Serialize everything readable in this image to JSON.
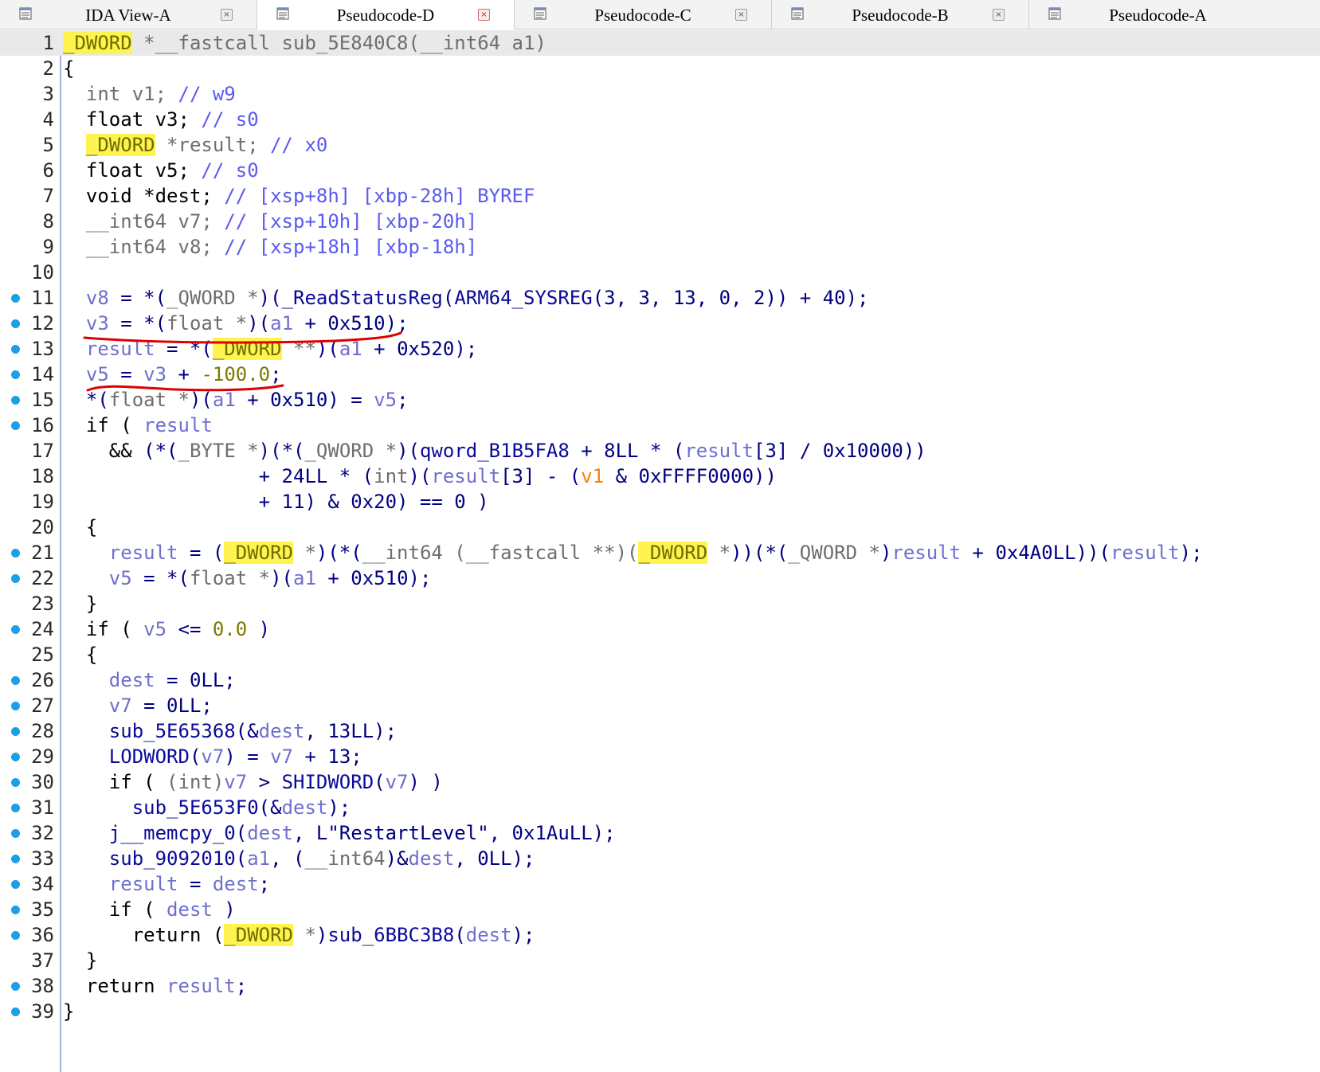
{
  "tabs": [
    {
      "label": "IDA View-A",
      "active": false
    },
    {
      "label": "Pseudocode-D",
      "active": true
    },
    {
      "label": "Pseudocode-C",
      "active": false
    },
    {
      "label": "Pseudocode-B",
      "active": false
    },
    {
      "label": "Pseudocode-A",
      "active": false
    }
  ],
  "close_glyph": "×",
  "colors": {
    "keyword": "#000080",
    "local_var": "#6f6fce",
    "type_gray": "#6e6e6e",
    "comment": "#5a5af0",
    "highlight_bg": "#fff34f",
    "breakpoint_dot": "#1aa0e8",
    "float_literal": "#7a7a00",
    "global_var": "#ff7f00",
    "annotation": "#e00000"
  },
  "code_lines": [
    {
      "n": "1",
      "bp": false,
      "current": true,
      "tokens": [
        [
          "hl",
          "_DWORD"
        ],
        [
          "ty",
          " *__fastcall "
        ],
        [
          "ty",
          "sub_5E840C8"
        ],
        [
          "ty",
          "(__int64 a1)"
        ]
      ]
    },
    {
      "n": "2",
      "bp": false,
      "tokens": [
        [
          "d",
          "{"
        ]
      ]
    },
    {
      "n": "3",
      "bp": false,
      "tokens": [
        [
          "d",
          "  "
        ],
        [
          "ty",
          "int v1; "
        ],
        [
          "cm",
          "// w9"
        ]
      ]
    },
    {
      "n": "4",
      "bp": false,
      "tokens": [
        [
          "d",
          "  float v3; "
        ],
        [
          "cm",
          "// s0"
        ]
      ]
    },
    {
      "n": "5",
      "bp": false,
      "tokens": [
        [
          "d",
          "  "
        ],
        [
          "hl",
          "_DWORD"
        ],
        [
          "ty",
          " *result; "
        ],
        [
          "cm",
          "// x0"
        ]
      ]
    },
    {
      "n": "6",
      "bp": false,
      "tokens": [
        [
          "d",
          "  float v5; "
        ],
        [
          "cm",
          "// s0"
        ]
      ]
    },
    {
      "n": "7",
      "bp": false,
      "tokens": [
        [
          "d",
          "  void *dest; "
        ],
        [
          "cm",
          "// [xsp+8h] [xbp-28h] BYREF"
        ]
      ]
    },
    {
      "n": "8",
      "bp": false,
      "tokens": [
        [
          "d",
          "  "
        ],
        [
          "ty",
          "__int64 v7; "
        ],
        [
          "cm",
          "// [xsp+10h] [xbp-20h]"
        ]
      ]
    },
    {
      "n": "9",
      "bp": false,
      "tokens": [
        [
          "d",
          "  "
        ],
        [
          "ty",
          "__int64 v8; "
        ],
        [
          "cm",
          "// [xsp+18h] [xbp-18h]"
        ]
      ]
    },
    {
      "n": "10",
      "bp": false,
      "tokens": []
    },
    {
      "n": "11",
      "bp": true,
      "tokens": [
        [
          "d",
          "  "
        ],
        [
          "lv",
          "v8"
        ],
        [
          "k",
          " = *("
        ],
        [
          "ty",
          "_QWORD *"
        ],
        [
          "k",
          ")("
        ],
        [
          "fn",
          "_ReadStatusReg"
        ],
        [
          "k",
          "("
        ],
        [
          "fn",
          "ARM64_SYSREG"
        ],
        [
          "k",
          "(3, 3, 13, 0, 2)) + 40);"
        ]
      ]
    },
    {
      "n": "12",
      "bp": true,
      "tokens": [
        [
          "d",
          "  "
        ],
        [
          "lv",
          "v3"
        ],
        [
          "k",
          " = *("
        ],
        [
          "ty",
          "float *"
        ],
        [
          "k",
          ")("
        ],
        [
          "lv",
          "a1"
        ],
        [
          "k",
          " + 0x510);"
        ]
      ]
    },
    {
      "n": "13",
      "bp": true,
      "tokens": [
        [
          "d",
          "  "
        ],
        [
          "lv",
          "result"
        ],
        [
          "k",
          " = *("
        ],
        [
          "hl",
          "_DWORD"
        ],
        [
          "ty",
          " **"
        ],
        [
          "k",
          ")("
        ],
        [
          "lv",
          "a1"
        ],
        [
          "k",
          " + 0x520);"
        ]
      ]
    },
    {
      "n": "14",
      "bp": true,
      "tokens": [
        [
          "d",
          "  "
        ],
        [
          "lv",
          "v5"
        ],
        [
          "k",
          " = "
        ],
        [
          "lv",
          "v3"
        ],
        [
          "k",
          " + "
        ],
        [
          "flt",
          "-100.0"
        ],
        [
          "k",
          ";"
        ]
      ]
    },
    {
      "n": "15",
      "bp": true,
      "tokens": [
        [
          "d",
          "  "
        ],
        [
          "k",
          "*("
        ],
        [
          "ty",
          "float *"
        ],
        [
          "k",
          ")("
        ],
        [
          "lv",
          "a1"
        ],
        [
          "k",
          " + 0x510) = "
        ],
        [
          "lv",
          "v5"
        ],
        [
          "k",
          ";"
        ]
      ]
    },
    {
      "n": "16",
      "bp": true,
      "tokens": [
        [
          "d",
          "  if ( "
        ],
        [
          "lv",
          "result"
        ]
      ]
    },
    {
      "n": "17",
      "bp": false,
      "tokens": [
        [
          "d",
          "    && "
        ],
        [
          "k",
          "(*("
        ],
        [
          "ty",
          "_BYTE *"
        ],
        [
          "k",
          ")(*("
        ],
        [
          "ty",
          "_QWORD *"
        ],
        [
          "k",
          ")("
        ],
        [
          "fn",
          "qword_B1B5FA8"
        ],
        [
          "k",
          " + 8LL * ("
        ],
        [
          "lv",
          "result"
        ],
        [
          "k",
          "[3] / 0x10000))"
        ]
      ]
    },
    {
      "n": "18",
      "bp": false,
      "tokens": [
        [
          "d",
          "                 "
        ],
        [
          "k",
          "+ 24LL * ("
        ],
        [
          "ty",
          "int"
        ],
        [
          "k",
          ")("
        ],
        [
          "lv",
          "result"
        ],
        [
          "k",
          "[3] - ("
        ],
        [
          "or",
          "v1"
        ],
        [
          "k",
          " & 0xFFFF0000))"
        ]
      ]
    },
    {
      "n": "19",
      "bp": false,
      "tokens": [
        [
          "d",
          "                 "
        ],
        [
          "k",
          "+ 11) & 0x20) == 0 )"
        ]
      ]
    },
    {
      "n": "20",
      "bp": false,
      "tokens": [
        [
          "d",
          "  {"
        ]
      ]
    },
    {
      "n": "21",
      "bp": true,
      "tokens": [
        [
          "d",
          "    "
        ],
        [
          "lv",
          "result"
        ],
        [
          "k",
          " = ("
        ],
        [
          "hl",
          "_DWORD"
        ],
        [
          "ty",
          " *"
        ],
        [
          "k",
          ")(*("
        ],
        [
          "ty",
          "__int64 (__fastcall **)("
        ],
        [
          "hl",
          "_DWORD"
        ],
        [
          "ty",
          " *"
        ],
        [
          "k",
          "))(*("
        ],
        [
          "ty",
          "_QWORD *"
        ],
        [
          "k",
          ")"
        ],
        [
          "lv",
          "result"
        ],
        [
          "k",
          " + 0x4A0LL))("
        ],
        [
          "lv",
          "result"
        ],
        [
          "k",
          ");"
        ]
      ]
    },
    {
      "n": "22",
      "bp": true,
      "tokens": [
        [
          "d",
          "    "
        ],
        [
          "lv",
          "v5"
        ],
        [
          "k",
          " = *("
        ],
        [
          "ty",
          "float *"
        ],
        [
          "k",
          ")("
        ],
        [
          "lv",
          "a1"
        ],
        [
          "k",
          " + 0x510);"
        ]
      ]
    },
    {
      "n": "23",
      "bp": false,
      "tokens": [
        [
          "d",
          "  }"
        ]
      ]
    },
    {
      "n": "24",
      "bp": true,
      "tokens": [
        [
          "d",
          "  if ( "
        ],
        [
          "lv",
          "v5"
        ],
        [
          "k",
          " <= "
        ],
        [
          "flt",
          "0.0"
        ],
        [
          "k",
          " )"
        ]
      ]
    },
    {
      "n": "25",
      "bp": false,
      "tokens": [
        [
          "d",
          "  {"
        ]
      ]
    },
    {
      "n": "26",
      "bp": true,
      "tokens": [
        [
          "d",
          "    "
        ],
        [
          "lv",
          "dest"
        ],
        [
          "k",
          " = 0LL;"
        ]
      ]
    },
    {
      "n": "27",
      "bp": true,
      "tokens": [
        [
          "d",
          "    "
        ],
        [
          "lv",
          "v7"
        ],
        [
          "k",
          " = 0LL;"
        ]
      ]
    },
    {
      "n": "28",
      "bp": true,
      "tokens": [
        [
          "d",
          "    "
        ],
        [
          "fn",
          "sub_5E65368"
        ],
        [
          "k",
          "(&"
        ],
        [
          "lv",
          "dest"
        ],
        [
          "k",
          ", 13LL);"
        ]
      ]
    },
    {
      "n": "29",
      "bp": true,
      "tokens": [
        [
          "d",
          "    "
        ],
        [
          "fn",
          "LODWORD"
        ],
        [
          "k",
          "("
        ],
        [
          "lv",
          "v7"
        ],
        [
          "k",
          ") = "
        ],
        [
          "lv",
          "v7"
        ],
        [
          "k",
          " + 13;"
        ]
      ]
    },
    {
      "n": "30",
      "bp": true,
      "tokens": [
        [
          "d",
          "    if ( "
        ],
        [
          "ty",
          "(int)"
        ],
        [
          "lv",
          "v7"
        ],
        [
          "k",
          " > "
        ],
        [
          "fn",
          "SHIDWORD"
        ],
        [
          "k",
          "("
        ],
        [
          "lv",
          "v7"
        ],
        [
          "k",
          ") )"
        ]
      ]
    },
    {
      "n": "31",
      "bp": true,
      "tokens": [
        [
          "d",
          "      "
        ],
        [
          "fn",
          "sub_5E653F0"
        ],
        [
          "k",
          "(&"
        ],
        [
          "lv",
          "dest"
        ],
        [
          "k",
          ");"
        ]
      ]
    },
    {
      "n": "32",
      "bp": true,
      "tokens": [
        [
          "d",
          "    "
        ],
        [
          "fn",
          "j__memcpy_0"
        ],
        [
          "k",
          "("
        ],
        [
          "lv",
          "dest"
        ],
        [
          "k",
          ", "
        ],
        [
          "str",
          "L\"RestartLevel\""
        ],
        [
          "k",
          ", 0x1AuLL);"
        ]
      ]
    },
    {
      "n": "33",
      "bp": true,
      "tokens": [
        [
          "d",
          "    "
        ],
        [
          "fn",
          "sub_9092010"
        ],
        [
          "k",
          "("
        ],
        [
          "lv",
          "a1"
        ],
        [
          "k",
          ", ("
        ],
        [
          "ty",
          "__int64"
        ],
        [
          "k",
          ")&"
        ],
        [
          "lv",
          "dest"
        ],
        [
          "k",
          ", 0LL);"
        ]
      ]
    },
    {
      "n": "34",
      "bp": true,
      "tokens": [
        [
          "d",
          "    "
        ],
        [
          "lv",
          "result"
        ],
        [
          "k",
          " = "
        ],
        [
          "lv",
          "dest"
        ],
        [
          "k",
          ";"
        ]
      ]
    },
    {
      "n": "35",
      "bp": true,
      "tokens": [
        [
          "d",
          "    if ( "
        ],
        [
          "lv",
          "dest"
        ],
        [
          "k",
          " )"
        ]
      ]
    },
    {
      "n": "36",
      "bp": true,
      "tokens": [
        [
          "d",
          "      return ("
        ],
        [
          "hl",
          "_DWORD"
        ],
        [
          "ty",
          " *"
        ],
        [
          "k",
          ")"
        ],
        [
          "fn",
          "sub_6BBC3B8"
        ],
        [
          "k",
          "("
        ],
        [
          "lv",
          "dest"
        ],
        [
          "k",
          ");"
        ]
      ]
    },
    {
      "n": "37",
      "bp": false,
      "tokens": [
        [
          "d",
          "  }"
        ]
      ]
    },
    {
      "n": "38",
      "bp": true,
      "tokens": [
        [
          "d",
          "  return "
        ],
        [
          "lv",
          "result"
        ],
        [
          "k",
          ";"
        ]
      ]
    },
    {
      "n": "39",
      "bp": true,
      "tokens": [
        [
          "d",
          "}"
        ]
      ]
    }
  ]
}
